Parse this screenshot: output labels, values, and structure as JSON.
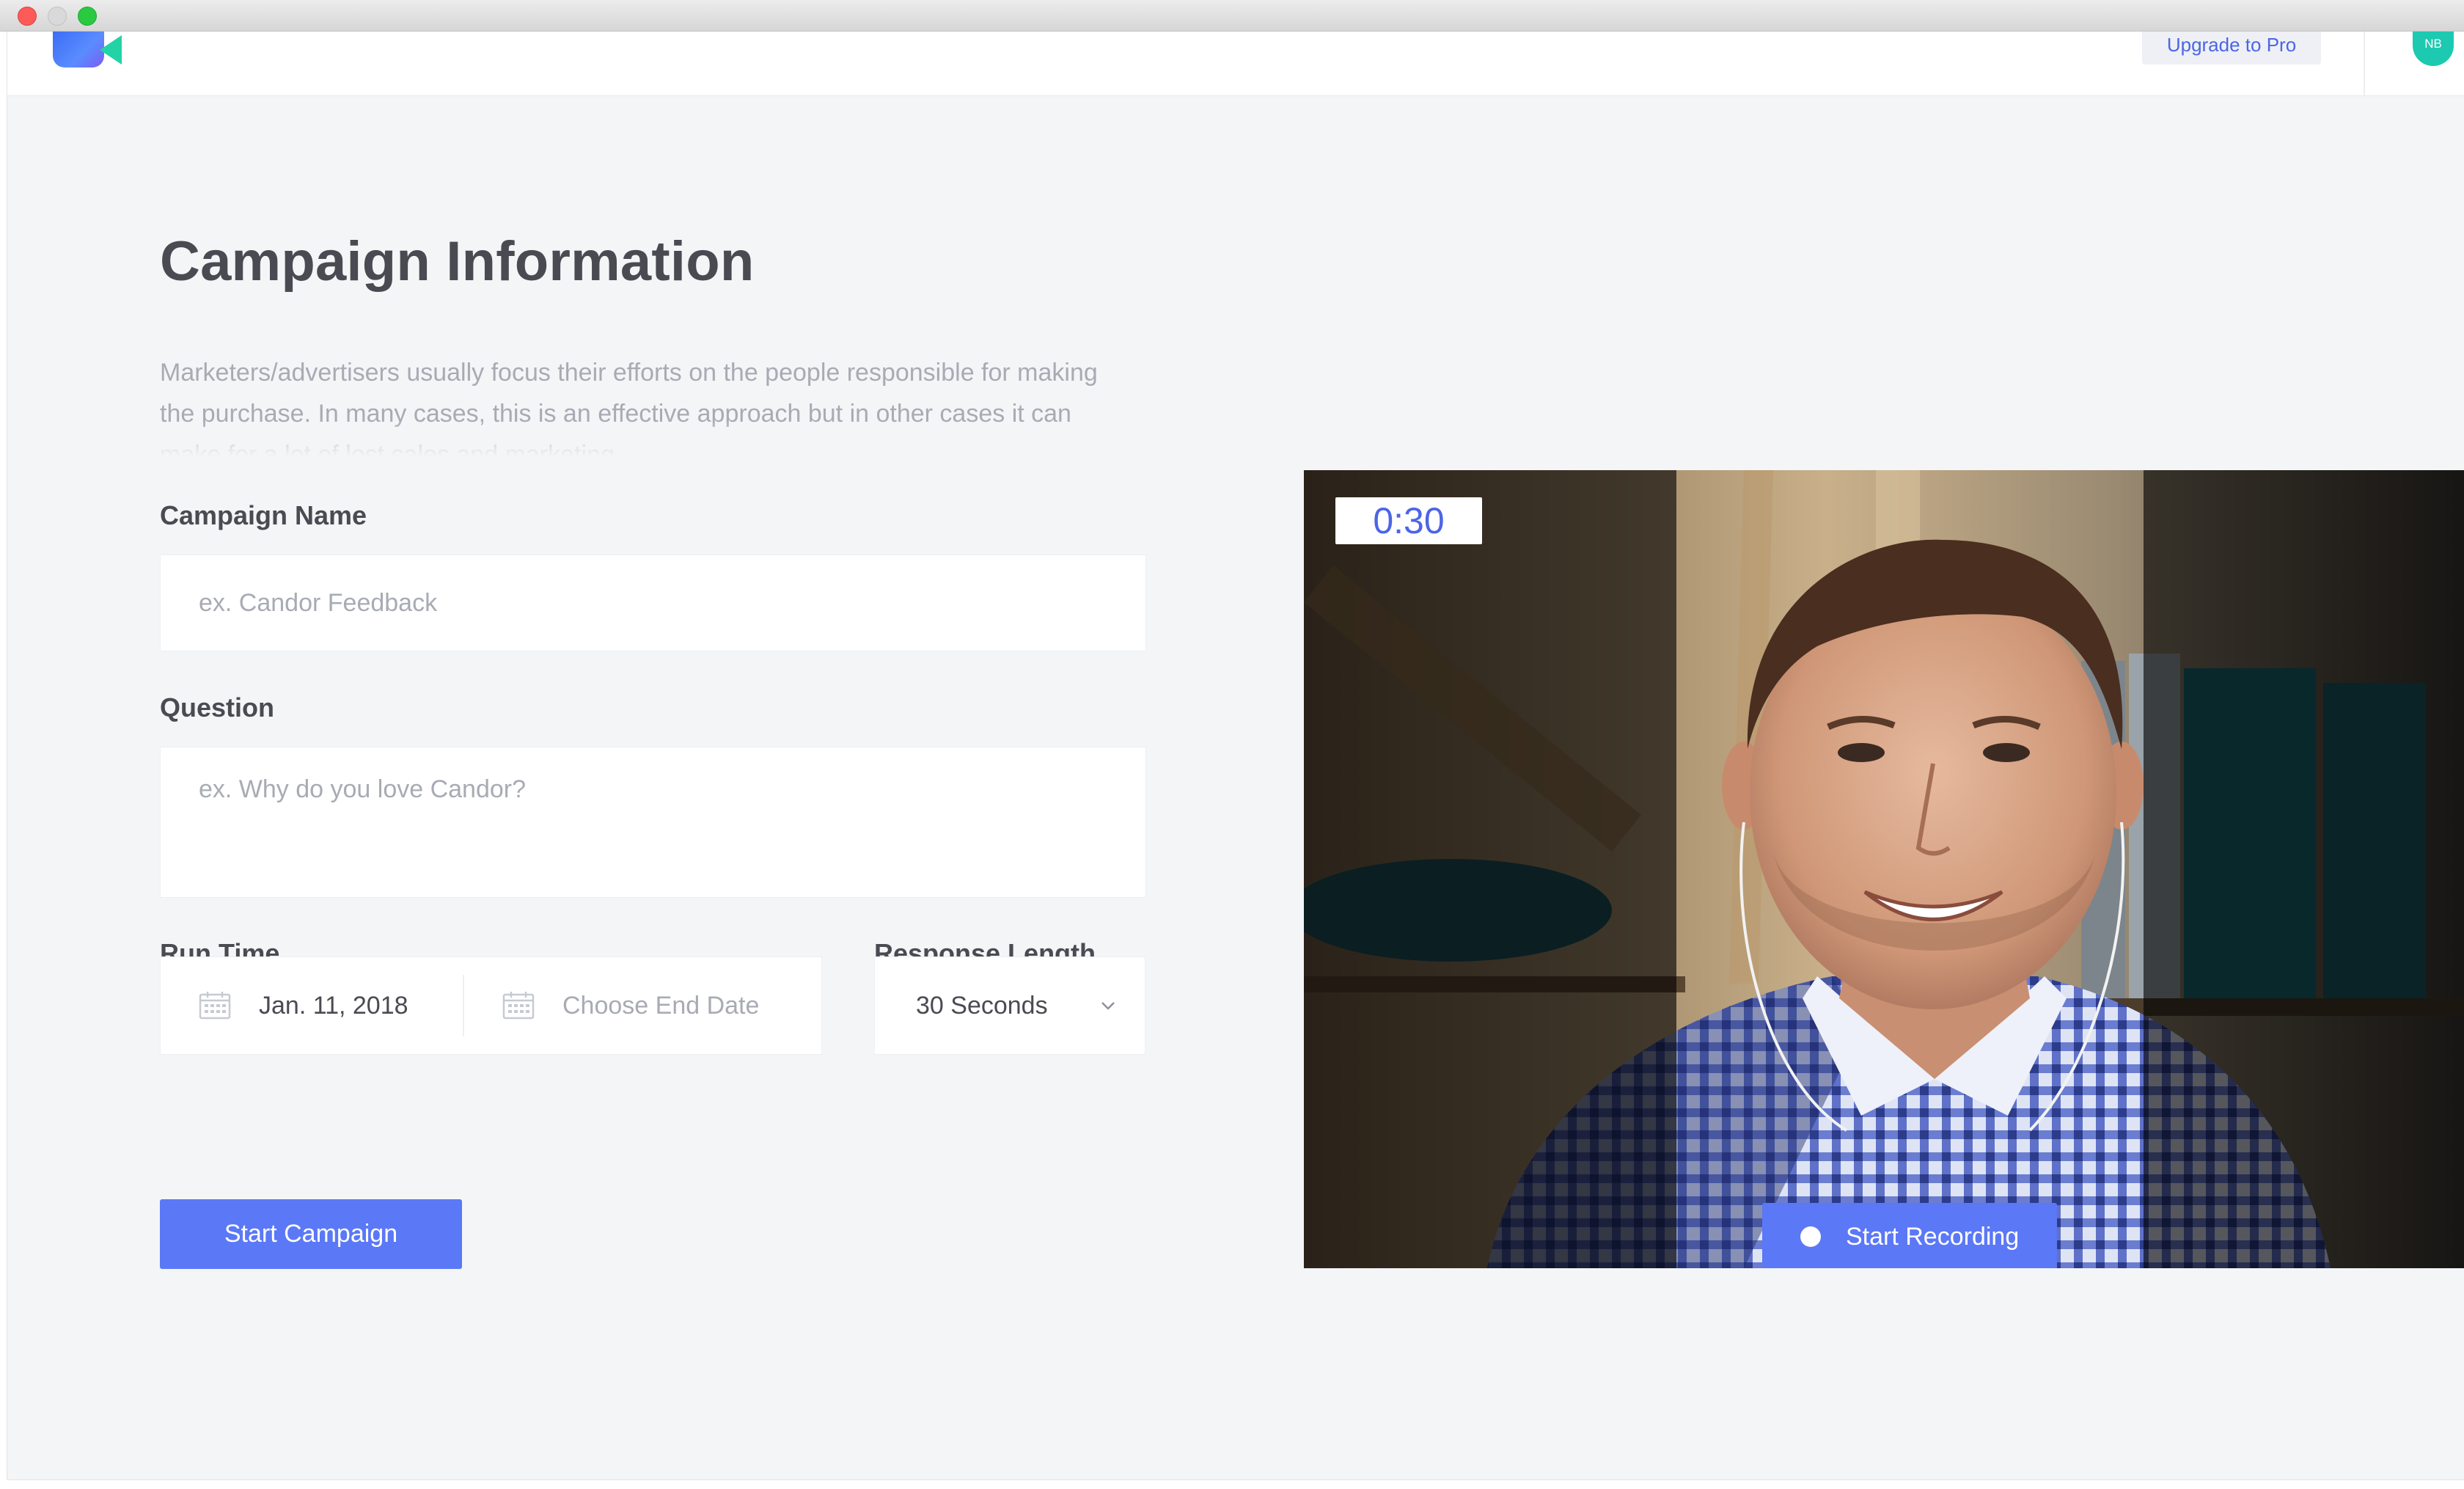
{
  "header": {
    "upgrade_label": "Upgrade to Pro",
    "avatar_initials": "NB"
  },
  "form": {
    "title": "Campaign Information",
    "description": "Marketers/advertisers usually focus their efforts on the people responsible for making the purchase. In many cases, this is an effective approach but in other cases it can make for a lot of lost sales and marketing.",
    "campaign_name": {
      "label": "Campaign Name",
      "value": "",
      "placeholder": "ex. Candor Feedback"
    },
    "question": {
      "label": "Question",
      "value": "",
      "placeholder": "ex. Why do you love Candor?"
    },
    "run_time": {
      "label": "Run Time",
      "start_date": "Jan. 11, 2018",
      "end_date_placeholder": "Choose End Date"
    },
    "response_length": {
      "label": "Response Length",
      "selected": "30 Seconds"
    },
    "submit_label": "Start Campaign"
  },
  "video": {
    "timer": "0:30",
    "record_label": "Start Recording"
  },
  "icons": {
    "logo": "video-camera-logo",
    "calendar": "calendar-icon",
    "dropdown": "chevron-down-icon",
    "record": "record-dot-icon"
  },
  "colors": {
    "accent": "#5b78f6",
    "accent_text": "#4c65e6",
    "avatar": "#1dc9b0",
    "page_bg": "#f4f5f7",
    "heading": "#4a4b52",
    "muted": "#a8abb4"
  }
}
